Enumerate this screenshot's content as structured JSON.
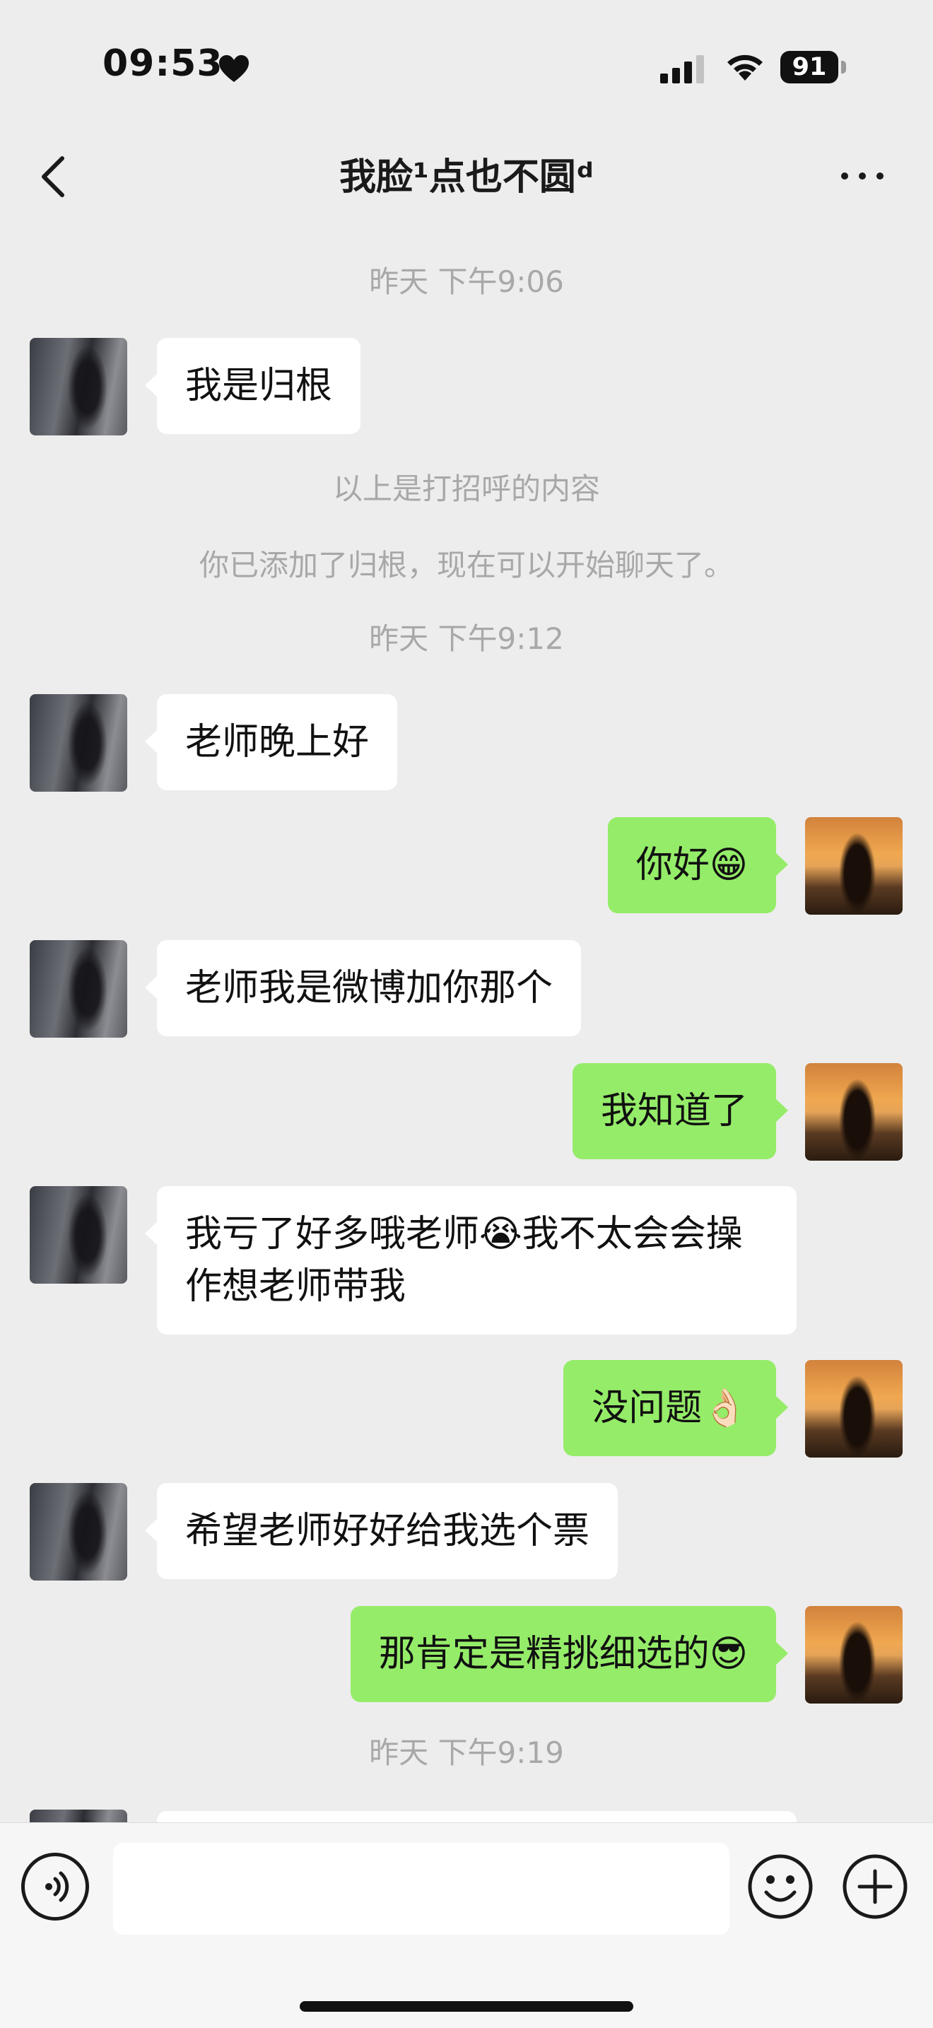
{
  "status_bar": {
    "time": "09:53",
    "battery": "91",
    "icons": [
      "heart-icon",
      "cellular-signal-icon",
      "wifi-icon",
      "battery-icon"
    ]
  },
  "header": {
    "title": "我脸¹点也不圆ᵈ",
    "back_icon": "chevron-left-icon",
    "more_icon": "more-dots-icon"
  },
  "chat": {
    "timestamps": [
      "昨天 下午9:06",
      "昨天 下午9:12",
      "昨天 下午9:19"
    ],
    "system_messages": [
      "以上是打招呼的内容",
      "你已添加了归根，现在可以开始聊天了。"
    ],
    "messages": [
      {
        "sender": "friend",
        "text": "我是归根"
      },
      {
        "sender": "friend",
        "text": "老师晚上好"
      },
      {
        "sender": "me",
        "text": "你好😁"
      },
      {
        "sender": "friend",
        "text": "老师我是微博加你那个"
      },
      {
        "sender": "me",
        "text": "我知道了"
      },
      {
        "sender": "friend",
        "text": "我亏了好多哦老师😭我不太会会操作想老师带我"
      },
      {
        "sender": "me",
        "text": "没问题👌🏻"
      },
      {
        "sender": "friend",
        "text": "希望老师好好给我选个票"
      },
      {
        "sender": "me",
        "text": "那肯定是精挑细选的😎"
      }
    ]
  },
  "input_bar": {
    "text_value": "",
    "icons": [
      "voice-icon",
      "emoji-icon",
      "plus-icon"
    ]
  },
  "colors": {
    "background": "#ededed",
    "my_bubble": "#95ec69",
    "friend_bubble": "#ffffff",
    "timestamp_text": "#a8a8a8"
  }
}
